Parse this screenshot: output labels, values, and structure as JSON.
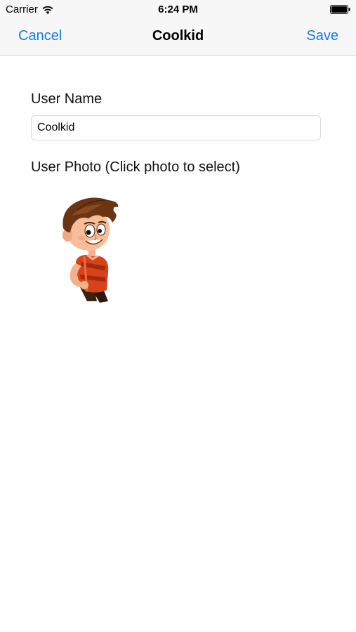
{
  "status_bar": {
    "carrier": "Carrier",
    "time": "6:24 PM",
    "wifi_icon": "wifi-icon",
    "battery_icon": "battery-icon"
  },
  "nav": {
    "cancel_label": "Cancel",
    "title": "Coolkid",
    "save_label": "Save",
    "accent_color": "#1a7ae6"
  },
  "form": {
    "username_label": "User Name",
    "username_value": "Coolkid",
    "photo_label": "User Photo (Click photo to select)",
    "photo_icon": "cartoon-boy-avatar"
  }
}
